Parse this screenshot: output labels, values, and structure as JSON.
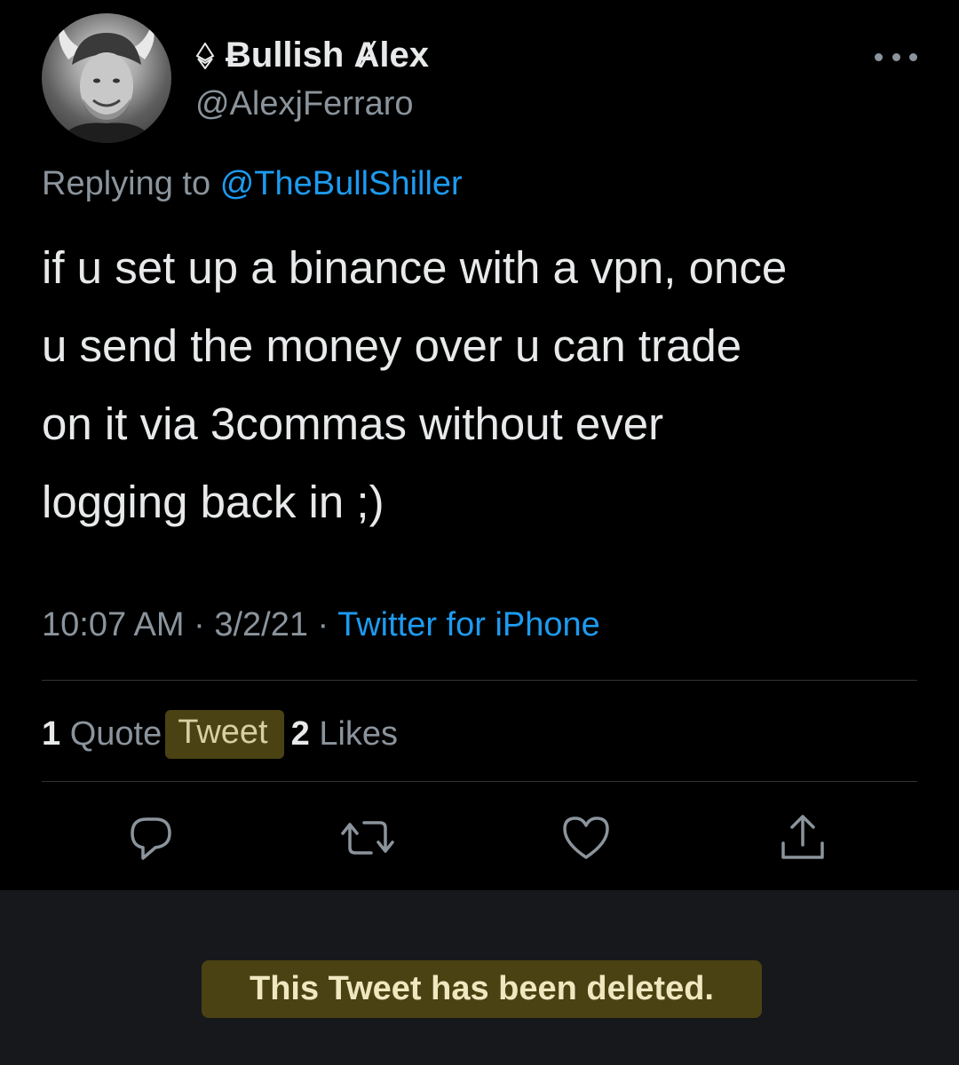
{
  "tweet": {
    "author": {
      "display_name": "Ƀullish Ⱥlex",
      "handle": "@AlexjFerraro"
    },
    "replying_to_prefix": "Replying to",
    "replying_to_handle": "@TheBullShiller",
    "text_lines": [
      "if u set up a binance with a vpn, once",
      "u send the money over u can trade",
      "on it via 3commas without ever",
      "logging back in ;)"
    ],
    "time": "10:07 AM",
    "separator": " · ",
    "date": "3/2/21",
    "source": "Twitter for iPhone",
    "stats": {
      "quote_count": "1",
      "quote_label_a": "Quote",
      "quote_label_b": "Tweet",
      "likes_count": "2",
      "likes_label": "Likes"
    }
  },
  "actions": {
    "reply_icon": "reply-icon",
    "retweet_icon": "retweet-icon",
    "like_icon": "heart-icon",
    "share_icon": "share-icon"
  },
  "deleted_notice": "This Tweet has been deleted.",
  "colors": {
    "background": "#000000",
    "text": "#e7e9ea",
    "secondary_text": "#8b949c",
    "link": "#1d9bf0",
    "highlight": "#4a4212",
    "panel": "#16181c"
  }
}
